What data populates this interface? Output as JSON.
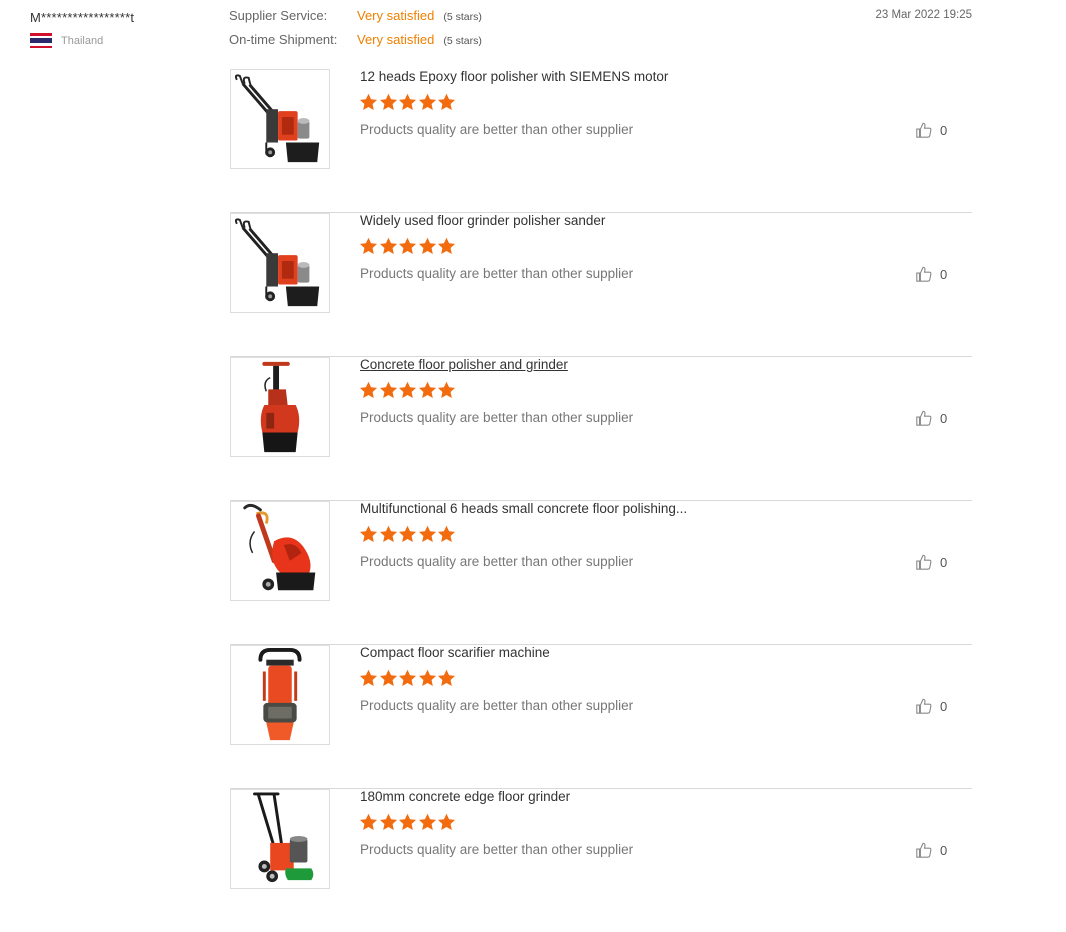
{
  "reviewer": {
    "name": "M*****************t",
    "country": "Thailand"
  },
  "ratings": [
    {
      "label": "Supplier Service:",
      "value": "Very satisfied",
      "stars": "(5 stars)"
    },
    {
      "label": "On-time Shipment:",
      "value": "Very satisfied",
      "stars": "(5 stars)"
    }
  ],
  "date": "23 Mar 2022 19:25",
  "colors": {
    "accent": "#ef7f00",
    "star": "#f26b0f",
    "divider": "#d9d9d9"
  },
  "products": [
    {
      "title": "12 heads Epoxy floor polisher with SIEMENS motor",
      "rating": 5,
      "comment": "Products quality are better than other supplier",
      "likes": "0",
      "icon": "floor-polisher-image"
    },
    {
      "title": "Widely used floor grinder polisher sander",
      "rating": 5,
      "comment": "Products quality are better than other supplier",
      "likes": "0",
      "icon": "floor-grinder-image"
    },
    {
      "title": "Concrete floor polisher and grinder",
      "rating": 5,
      "comment": "Products quality are better than other supplier",
      "likes": "0",
      "icon": "concrete-polisher-image"
    },
    {
      "title": "Multifunctional 6 heads small concrete floor polishing...",
      "rating": 5,
      "comment": "Products quality are better than other supplier",
      "likes": "0",
      "icon": "multifunctional-polisher-image"
    },
    {
      "title": "Compact floor scarifier machine",
      "rating": 5,
      "comment": "Products quality are better than other supplier",
      "likes": "0",
      "icon": "scarifier-image"
    },
    {
      "title": "180mm concrete edge floor grinder",
      "rating": 5,
      "comment": "Products quality are better than other supplier",
      "likes": "0",
      "icon": "edge-grinder-image"
    }
  ]
}
